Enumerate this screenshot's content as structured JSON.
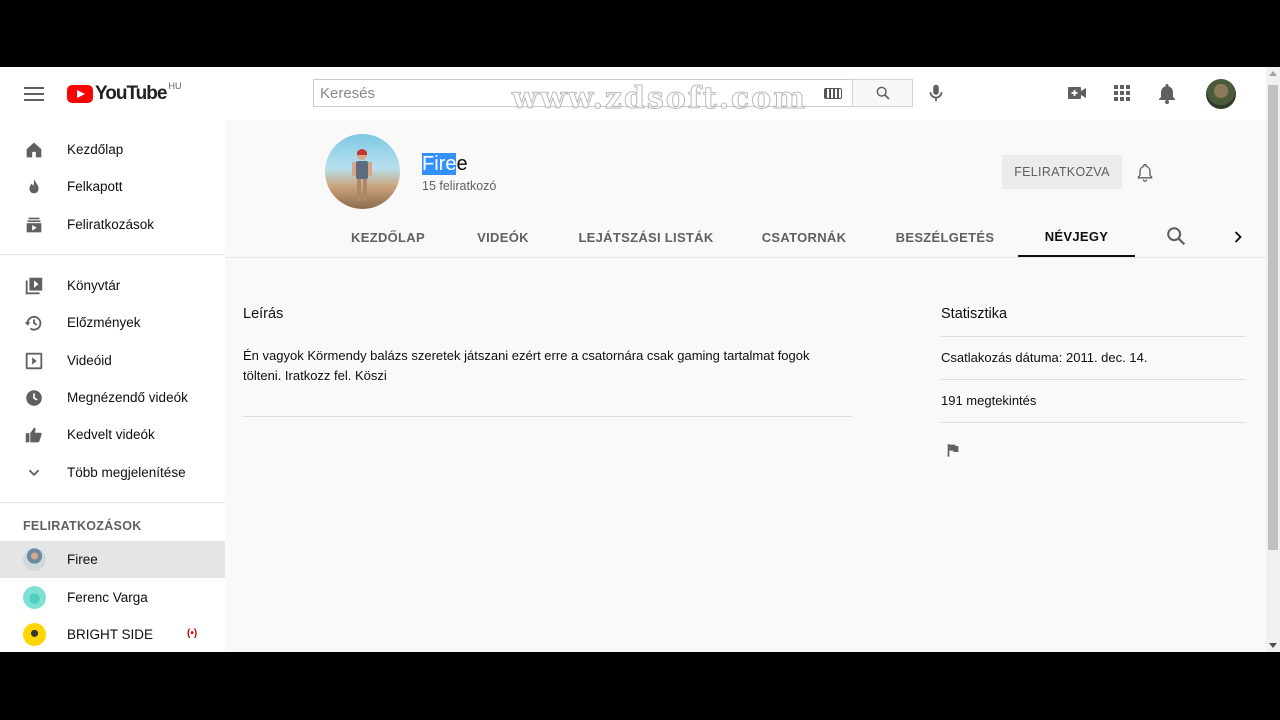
{
  "header": {
    "logo_text": "YouTube",
    "region": "HU",
    "search_placeholder": "Keresés",
    "watermark": "www.zdsoft.com"
  },
  "sidebar": {
    "items": [
      {
        "label": "Kezdőlap",
        "icon": "home-icon"
      },
      {
        "label": "Felkapott",
        "icon": "flame-icon"
      },
      {
        "label": "Feliratkozások",
        "icon": "subscriptions-icon"
      },
      {
        "label": "Könyvtár",
        "icon": "library-icon"
      },
      {
        "label": "Előzmények",
        "icon": "history-icon"
      },
      {
        "label": "Videóid",
        "icon": "your-videos-icon"
      },
      {
        "label": "Megnézendő videók",
        "icon": "watch-later-icon"
      },
      {
        "label": "Kedvelt videók",
        "icon": "thumbs-up-icon"
      },
      {
        "label": "Több megjelenítése",
        "icon": "chevron-down-icon"
      }
    ],
    "subscriptions_heading": "FELIRATKOZÁSOK",
    "subscriptions": [
      {
        "label": "Firee"
      },
      {
        "label": "Ferenc Varga"
      },
      {
        "label": "BRIGHT SIDE",
        "live": "(•)"
      }
    ]
  },
  "channel": {
    "name_selected": "Fire",
    "name_rest": "e",
    "subscribers": "15 feliratkozó",
    "subscribed_label": "FELIRATKOZVA"
  },
  "tabs": [
    {
      "label": "KEZDŐLAP"
    },
    {
      "label": "VIDEÓK"
    },
    {
      "label": "LEJÁTSZÁSI LISTÁK"
    },
    {
      "label": "CSATORNÁK"
    },
    {
      "label": "BESZÉLGETÉS"
    },
    {
      "label": "NÉVJEGY",
      "active": true
    }
  ],
  "about": {
    "description_title": "Leírás",
    "description": "Én vagyok Körmendy balázs szeretek játszani ezért erre a csatornára csak gaming tartalmat fogok tölteni. Iratkozz fel. Köszi",
    "stats_title": "Statisztika",
    "joined": "Csatlakozás dátuma: 2011. dec. 14.",
    "views": "191 megtekintés"
  },
  "colors": {
    "brand_red": "#ff0000",
    "selection": "#3390ff",
    "live_red": "#cc0000"
  }
}
